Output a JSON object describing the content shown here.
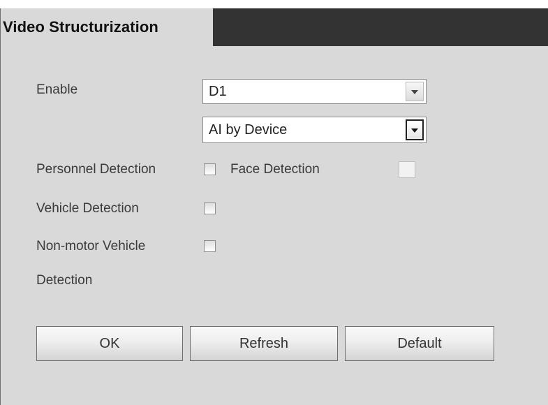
{
  "header": {
    "title": "Video Structurization"
  },
  "form": {
    "enable_label": "Enable",
    "channel_select": {
      "value": "D1",
      "icon": "chevron-down-icon"
    },
    "mode_select": {
      "value": "AI by Device",
      "icon": "chevron-down-icon"
    },
    "personnel_detection": {
      "label": "Personnel Detection",
      "checked": false
    },
    "face_detection": {
      "label": "Face Detection",
      "checked": false
    },
    "vehicle_detection": {
      "label": "Vehicle Detection",
      "checked": false
    },
    "non_motor_detection": {
      "label_line1": "Non-motor Vehicle",
      "label_line2": "Detection",
      "checked": false
    }
  },
  "buttons": {
    "ok": "OK",
    "refresh": "Refresh",
    "default": "Default"
  },
  "colors": {
    "panel_bg": "#d9d9d9",
    "header_bg": "#333333",
    "text": "#333333"
  }
}
